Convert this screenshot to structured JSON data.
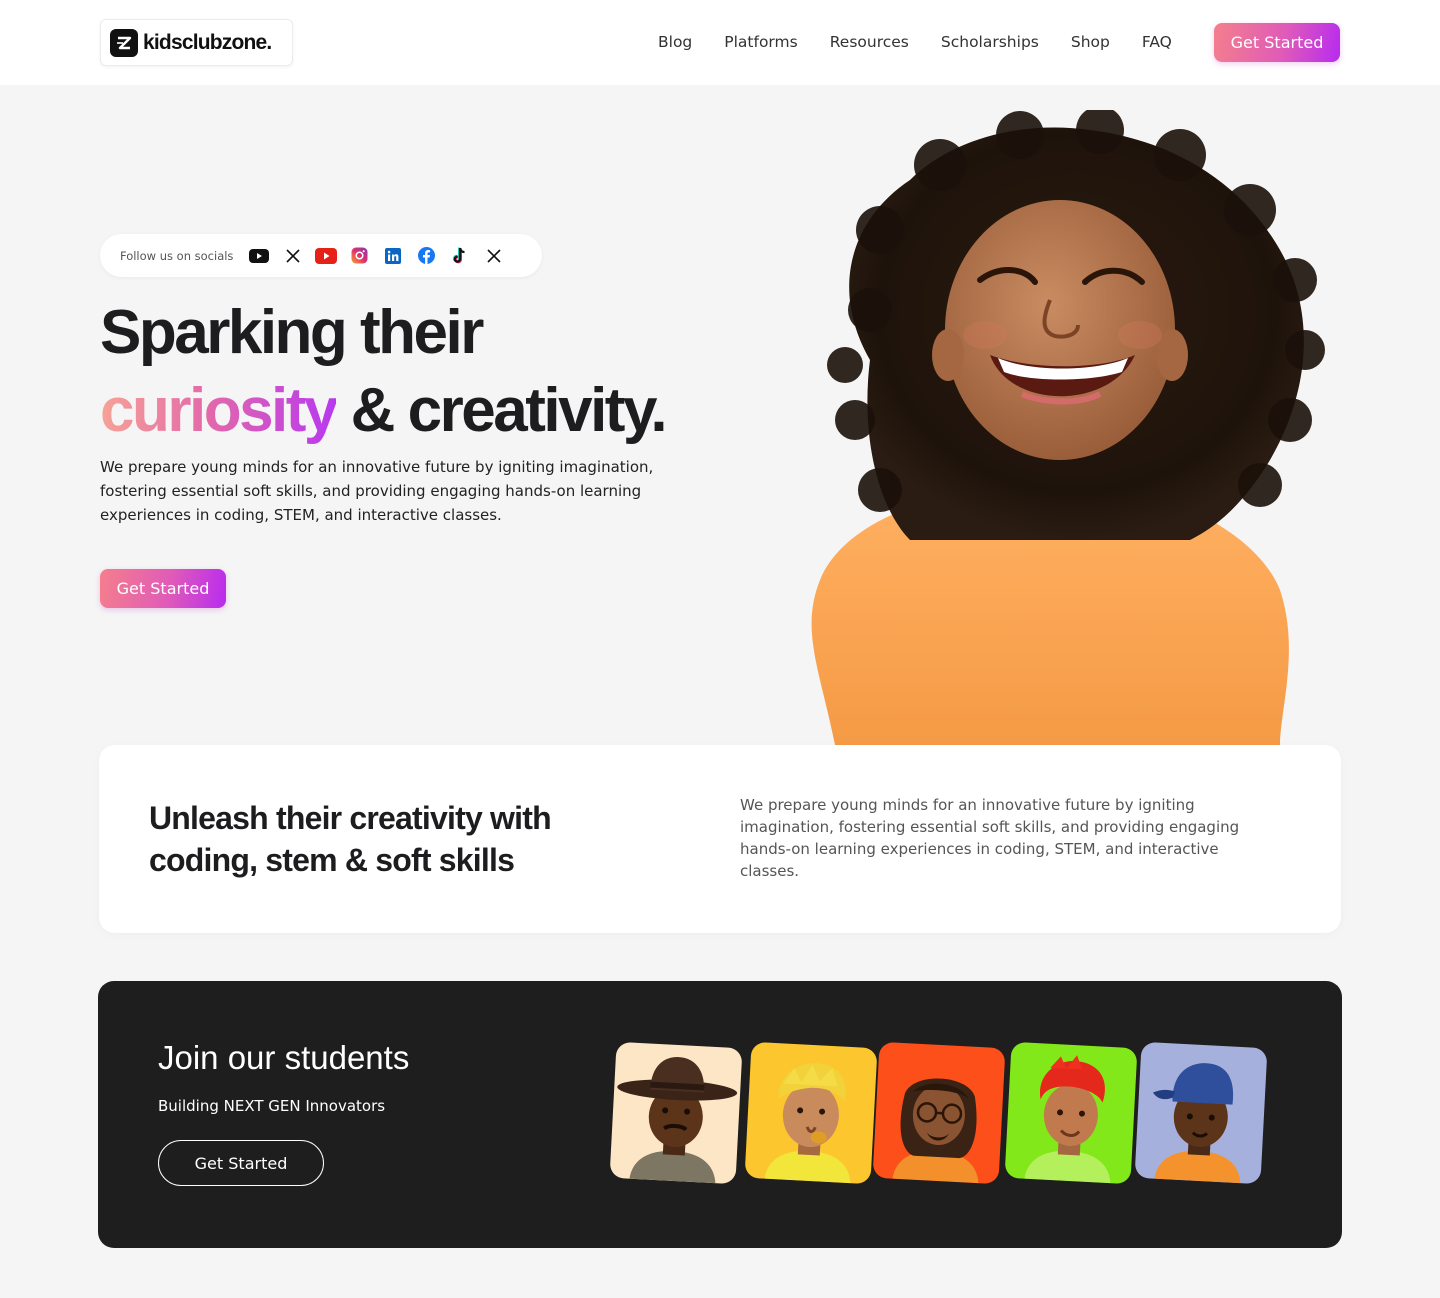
{
  "header": {
    "logo_text": "kidsclubzone.",
    "nav": [
      "Blog",
      "Platforms",
      "Resources",
      "Scholarships",
      "Shop",
      "FAQ"
    ],
    "cta": "Get Started"
  },
  "socials": {
    "label": "Follow us on socials",
    "icons": [
      "youtube-icon",
      "x-icon",
      "youtube-icon",
      "instagram-icon",
      "linkedin-icon",
      "facebook-icon",
      "tiktok-icon",
      "x-icon"
    ]
  },
  "hero": {
    "title_line1": "Sparking their",
    "title_highlight": "curiosity",
    "title_rest": " & creativity.",
    "description": "We prepare young minds for an innovative future by igniting imagination, fostering essential soft skills, and providing engaging hands-on learning experiences in coding, STEM, and interactive classes.",
    "cta": "Get Started"
  },
  "feature": {
    "title": "Unleash their creativity with coding, stem & soft skills",
    "description": "We prepare young minds for an innovative future by igniting imagination, fostering essential soft skills, and providing engaging hands-on learning experiences in coding, STEM, and interactive classes."
  },
  "join": {
    "title": "Join our students",
    "subtitle": "Building NEXT GEN Innovators",
    "cta": "Get Started",
    "avatar_colors": [
      "#fde6c6",
      "#fcc72e",
      "#fc4f19",
      "#82e81a",
      "#a6b0dc"
    ]
  },
  "colors": {
    "accent_gradient_start": "#f47f8c",
    "accent_gradient_end": "#b72bf0",
    "dark_banner": "#1e1e1e"
  }
}
